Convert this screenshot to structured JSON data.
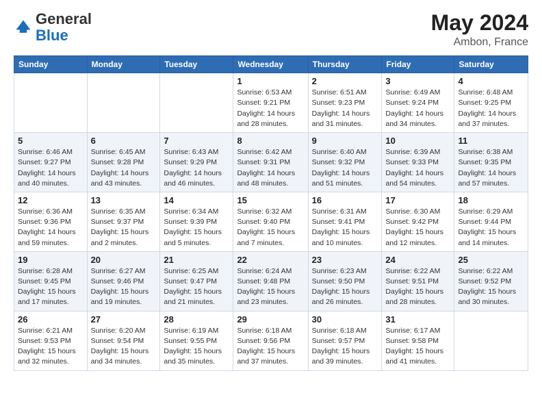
{
  "header": {
    "logo_general": "General",
    "logo_blue": "Blue",
    "month_year": "May 2024",
    "location": "Ambon, France"
  },
  "days_of_week": [
    "Sunday",
    "Monday",
    "Tuesday",
    "Wednesday",
    "Thursday",
    "Friday",
    "Saturday"
  ],
  "weeks": [
    [
      {
        "day": "",
        "info": ""
      },
      {
        "day": "",
        "info": ""
      },
      {
        "day": "",
        "info": ""
      },
      {
        "day": "1",
        "info": "Sunrise: 6:53 AM\nSunset: 9:21 PM\nDaylight: 14 hours\nand 28 minutes."
      },
      {
        "day": "2",
        "info": "Sunrise: 6:51 AM\nSunset: 9:23 PM\nDaylight: 14 hours\nand 31 minutes."
      },
      {
        "day": "3",
        "info": "Sunrise: 6:49 AM\nSunset: 9:24 PM\nDaylight: 14 hours\nand 34 minutes."
      },
      {
        "day": "4",
        "info": "Sunrise: 6:48 AM\nSunset: 9:25 PM\nDaylight: 14 hours\nand 37 minutes."
      }
    ],
    [
      {
        "day": "5",
        "info": "Sunrise: 6:46 AM\nSunset: 9:27 PM\nDaylight: 14 hours\nand 40 minutes."
      },
      {
        "day": "6",
        "info": "Sunrise: 6:45 AM\nSunset: 9:28 PM\nDaylight: 14 hours\nand 43 minutes."
      },
      {
        "day": "7",
        "info": "Sunrise: 6:43 AM\nSunset: 9:29 PM\nDaylight: 14 hours\nand 46 minutes."
      },
      {
        "day": "8",
        "info": "Sunrise: 6:42 AM\nSunset: 9:31 PM\nDaylight: 14 hours\nand 48 minutes."
      },
      {
        "day": "9",
        "info": "Sunrise: 6:40 AM\nSunset: 9:32 PM\nDaylight: 14 hours\nand 51 minutes."
      },
      {
        "day": "10",
        "info": "Sunrise: 6:39 AM\nSunset: 9:33 PM\nDaylight: 14 hours\nand 54 minutes."
      },
      {
        "day": "11",
        "info": "Sunrise: 6:38 AM\nSunset: 9:35 PM\nDaylight: 14 hours\nand 57 minutes."
      }
    ],
    [
      {
        "day": "12",
        "info": "Sunrise: 6:36 AM\nSunset: 9:36 PM\nDaylight: 14 hours\nand 59 minutes."
      },
      {
        "day": "13",
        "info": "Sunrise: 6:35 AM\nSunset: 9:37 PM\nDaylight: 15 hours\nand 2 minutes."
      },
      {
        "day": "14",
        "info": "Sunrise: 6:34 AM\nSunset: 9:39 PM\nDaylight: 15 hours\nand 5 minutes."
      },
      {
        "day": "15",
        "info": "Sunrise: 6:32 AM\nSunset: 9:40 PM\nDaylight: 15 hours\nand 7 minutes."
      },
      {
        "day": "16",
        "info": "Sunrise: 6:31 AM\nSunset: 9:41 PM\nDaylight: 15 hours\nand 10 minutes."
      },
      {
        "day": "17",
        "info": "Sunrise: 6:30 AM\nSunset: 9:42 PM\nDaylight: 15 hours\nand 12 minutes."
      },
      {
        "day": "18",
        "info": "Sunrise: 6:29 AM\nSunset: 9:44 PM\nDaylight: 15 hours\nand 14 minutes."
      }
    ],
    [
      {
        "day": "19",
        "info": "Sunrise: 6:28 AM\nSunset: 9:45 PM\nDaylight: 15 hours\nand 17 minutes."
      },
      {
        "day": "20",
        "info": "Sunrise: 6:27 AM\nSunset: 9:46 PM\nDaylight: 15 hours\nand 19 minutes."
      },
      {
        "day": "21",
        "info": "Sunrise: 6:25 AM\nSunset: 9:47 PM\nDaylight: 15 hours\nand 21 minutes."
      },
      {
        "day": "22",
        "info": "Sunrise: 6:24 AM\nSunset: 9:48 PM\nDaylight: 15 hours\nand 23 minutes."
      },
      {
        "day": "23",
        "info": "Sunrise: 6:23 AM\nSunset: 9:50 PM\nDaylight: 15 hours\nand 26 minutes."
      },
      {
        "day": "24",
        "info": "Sunrise: 6:22 AM\nSunset: 9:51 PM\nDaylight: 15 hours\nand 28 minutes."
      },
      {
        "day": "25",
        "info": "Sunrise: 6:22 AM\nSunset: 9:52 PM\nDaylight: 15 hours\nand 30 minutes."
      }
    ],
    [
      {
        "day": "26",
        "info": "Sunrise: 6:21 AM\nSunset: 9:53 PM\nDaylight: 15 hours\nand 32 minutes."
      },
      {
        "day": "27",
        "info": "Sunrise: 6:20 AM\nSunset: 9:54 PM\nDaylight: 15 hours\nand 34 minutes."
      },
      {
        "day": "28",
        "info": "Sunrise: 6:19 AM\nSunset: 9:55 PM\nDaylight: 15 hours\nand 35 minutes."
      },
      {
        "day": "29",
        "info": "Sunrise: 6:18 AM\nSunset: 9:56 PM\nDaylight: 15 hours\nand 37 minutes."
      },
      {
        "day": "30",
        "info": "Sunrise: 6:18 AM\nSunset: 9:57 PM\nDaylight: 15 hours\nand 39 minutes."
      },
      {
        "day": "31",
        "info": "Sunrise: 6:17 AM\nSunset: 9:58 PM\nDaylight: 15 hours\nand 41 minutes."
      },
      {
        "day": "",
        "info": ""
      }
    ]
  ]
}
